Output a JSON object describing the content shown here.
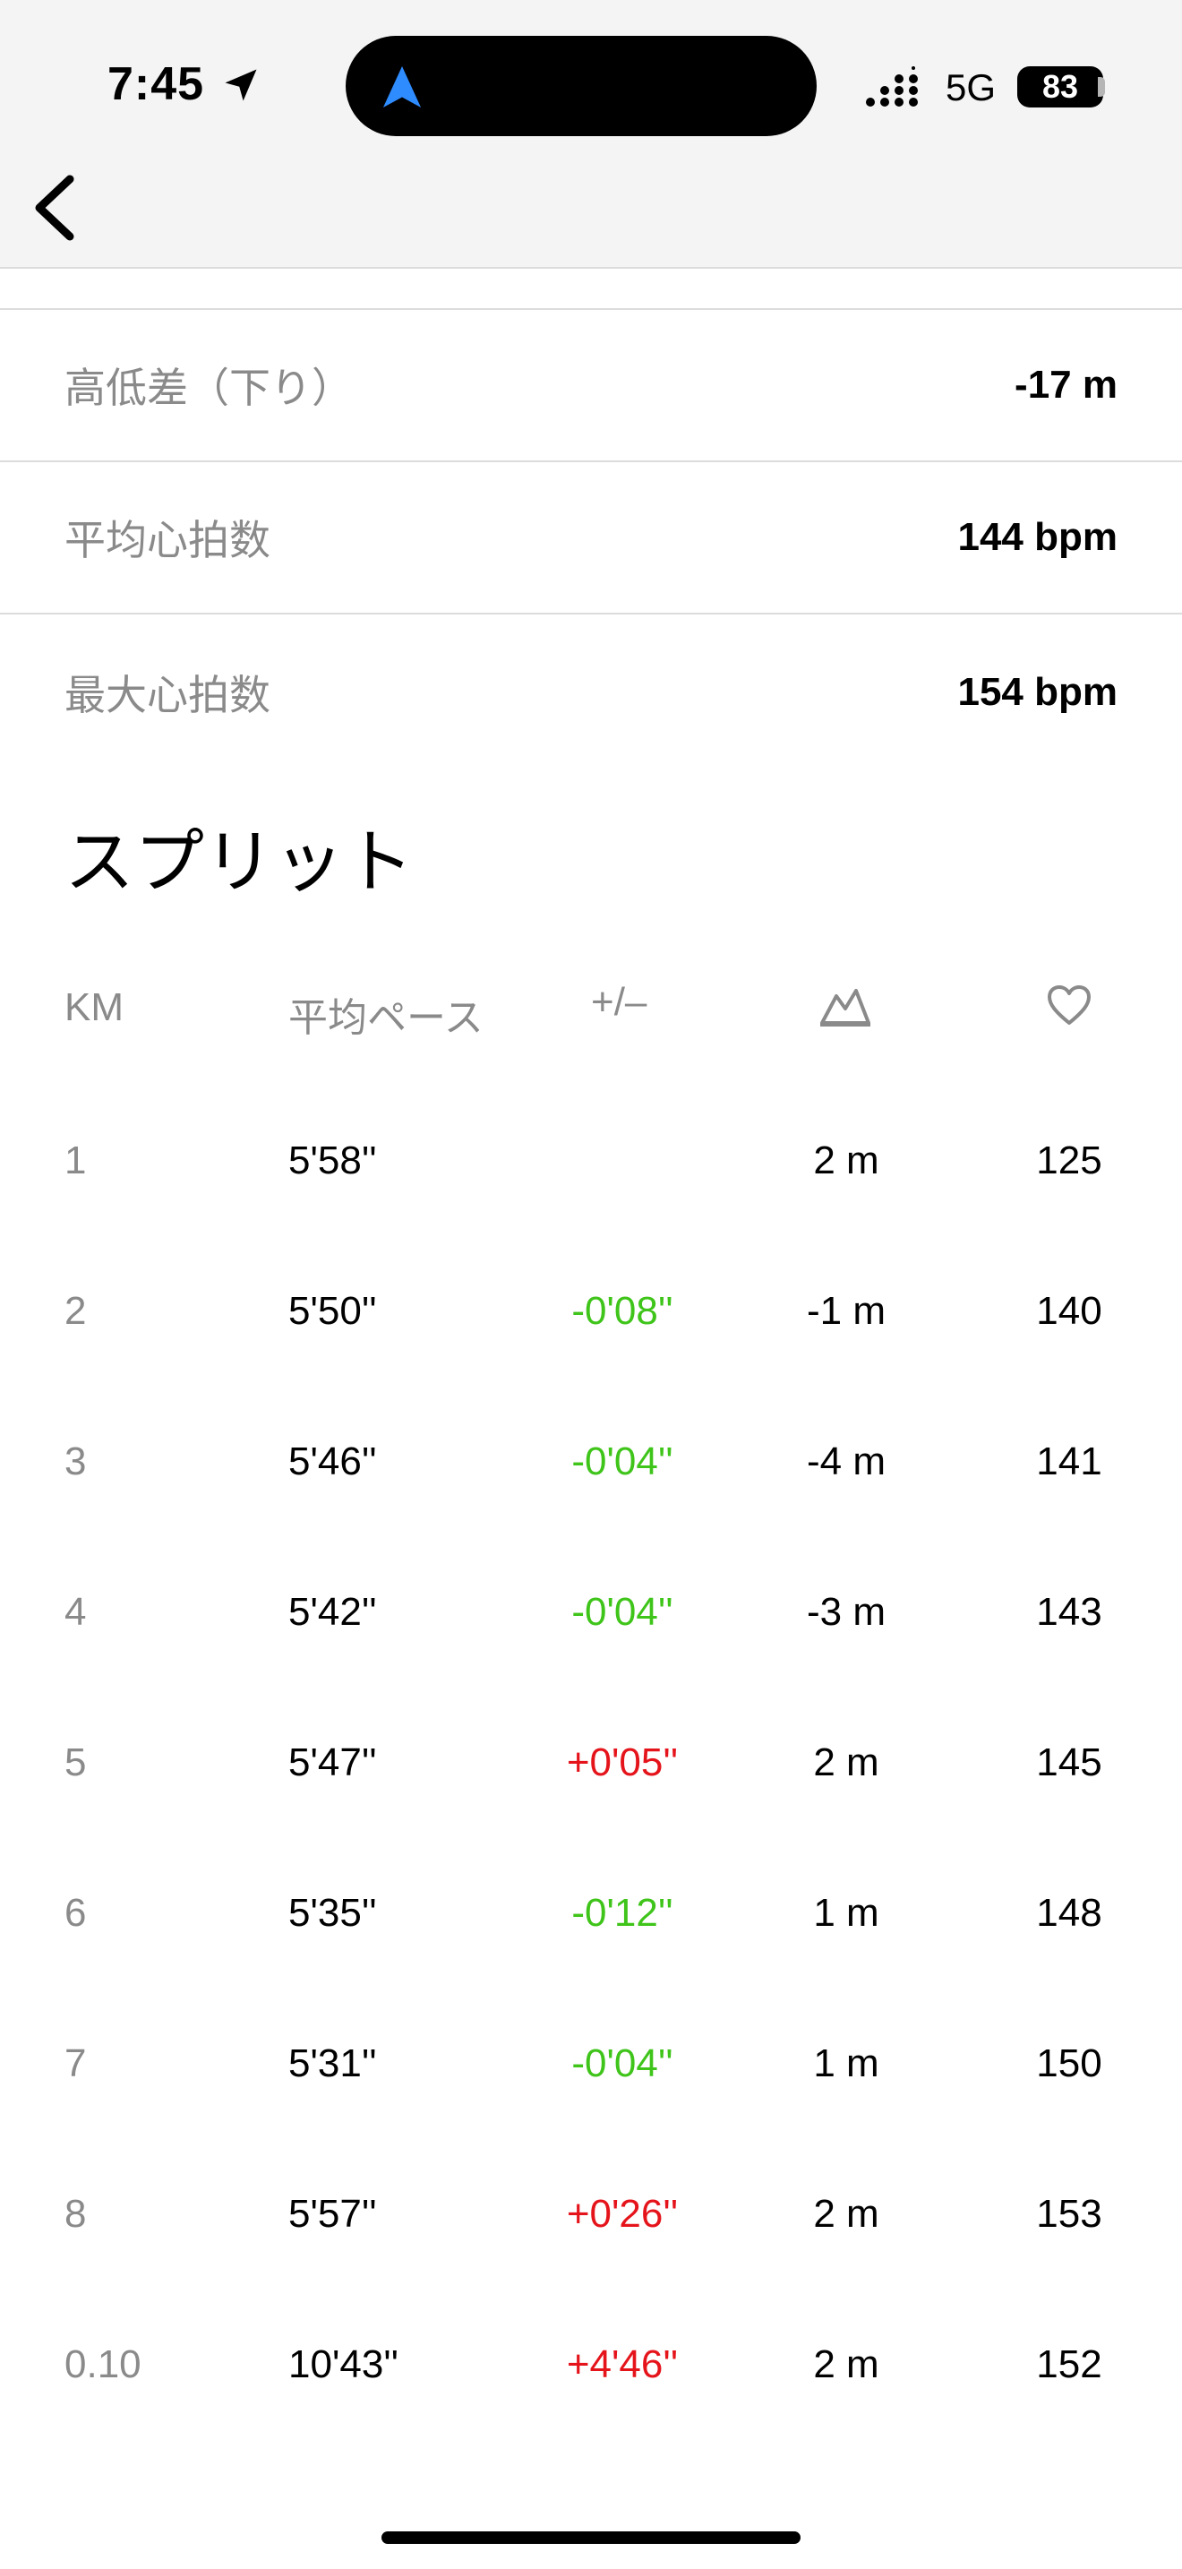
{
  "status_bar": {
    "time": "7:45",
    "network": "5G",
    "battery": "83",
    "icons": [
      "location-arrow-icon",
      "navigation-icon",
      "signal-icon",
      "battery-icon"
    ]
  },
  "nav": {
    "back_icon": "chevron-left-icon"
  },
  "stats": [
    {
      "label": "高低差（下り）",
      "value": "-17 m"
    },
    {
      "label": "平均心拍数",
      "value": "144 bpm"
    },
    {
      "label": "最大心拍数",
      "value": "154 bpm"
    }
  ],
  "splits": {
    "title": "スプリット",
    "headers": {
      "km": "KM",
      "pace": "平均ペース",
      "diff": "+/–",
      "elevation_icon": "elevation-icon",
      "heart_icon": "heart-icon"
    },
    "rows": [
      {
        "km": "1",
        "pace": "5'58''",
        "diff": "",
        "elev": "2 m",
        "hr": "125"
      },
      {
        "km": "2",
        "pace": "5'50''",
        "diff": "-0'08''",
        "elev": "-1 m",
        "hr": "140"
      },
      {
        "km": "3",
        "pace": "5'46''",
        "diff": "-0'04''",
        "elev": "-4 m",
        "hr": "141"
      },
      {
        "km": "4",
        "pace": "5'42''",
        "diff": "-0'04''",
        "elev": "-3 m",
        "hr": "143"
      },
      {
        "km": "5",
        "pace": "5'47''",
        "diff": "+0'05''",
        "elev": "2 m",
        "hr": "145"
      },
      {
        "km": "6",
        "pace": "5'35''",
        "diff": "-0'12''",
        "elev": "1 m",
        "hr": "148"
      },
      {
        "km": "7",
        "pace": "5'31''",
        "diff": "-0'04''",
        "elev": "1 m",
        "hr": "150"
      },
      {
        "km": "8",
        "pace": "5'57''",
        "diff": "+0'26''",
        "elev": "2 m",
        "hr": "153"
      },
      {
        "km": "0.10",
        "pace": "10'43''",
        "diff": "+4'46''",
        "elev": "2 m",
        "hr": "152"
      }
    ]
  },
  "colors": {
    "faster": "#3fc41a",
    "slower": "#e5141b",
    "muted": "#8a8a8a"
  }
}
